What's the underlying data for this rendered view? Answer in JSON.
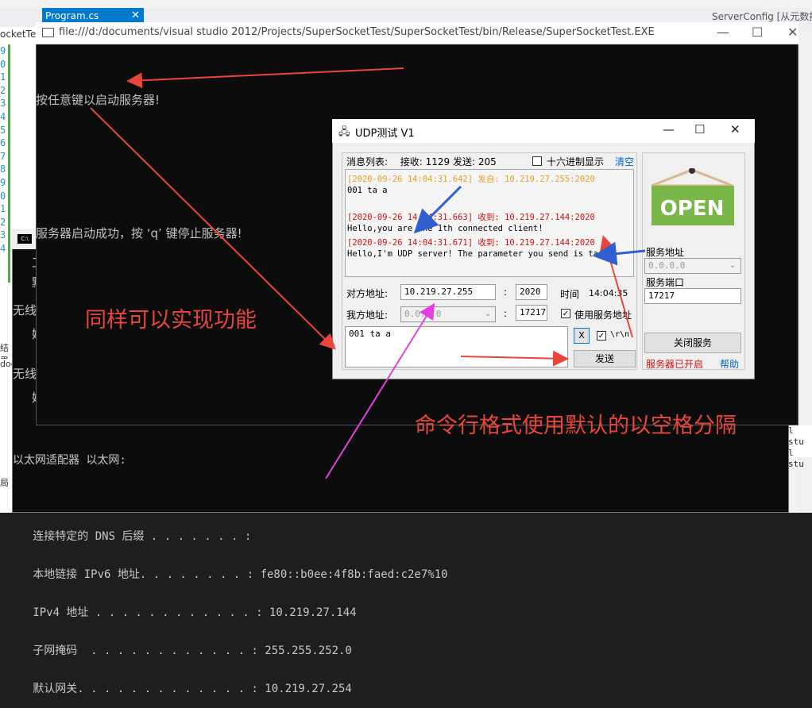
{
  "ide": {
    "tab_label": "Program.cs",
    "tab_icons": "⊕ ⊣",
    "right_title": "ServerConfig [从元数据",
    "left_text": "ocketTest",
    "line_numbers": [
      "9",
      "0",
      "1",
      "2",
      "3",
      "4",
      "5",
      "6",
      "7",
      "8",
      "9",
      "0",
      "1",
      "2",
      "3",
      "4"
    ],
    "left_fragments": [
      "无线",
      "无线",
      "结果",
      "doc",
      "局"
    ],
    "right_output": [
      "l stu",
      "l stu"
    ]
  },
  "console": {
    "title": "file:///d:/documents/visual studio 2012/Projects/SuperSocketTest/SuperSocketTest/bin/Release/SuperSocketTest.EXE",
    "lines": [
      "按任意键以启动服务器!",
      "",
      "服务器启动成功，按 ‘q’ 键停止服务器!"
    ]
  },
  "cmd2": {
    "icon_text": "C:\\",
    "adapter_lines": [
      "以太网适配器 以太网:",
      "",
      "   连接特定的 DNS 后缀 . . . . . . . :",
      "   本地链接 IPv6 地址. . . . . . . . : fe80::b0ee:4f8b:faed:c2e7%10",
      "   IPv4 地址 . . . . . . . . . . . . : 10.219.27.144",
      "   子网掩码  . . . . . . . . . . . . : 255.255.252.0",
      "   默认网关. . . . . . . . . . . . . : 10.219.27.254"
    ]
  },
  "udp": {
    "title": "UDP测试 V1",
    "msg_list_label": "消息列表:",
    "recv_label": "接收:",
    "recv_count": "1129",
    "send_label": "发送:",
    "send_count": "205",
    "hex_label": "十六进制显示",
    "clear_label": "清空",
    "messages": [
      {
        "text": "[2020-09-26 14:04:31.642]  发自: 10.219.27.255:2020",
        "color": "orange"
      },
      {
        "text": "001 ta a",
        "color": "black"
      },
      {
        "text": "",
        "color": "black"
      },
      {
        "text": "[2020-09-26 14:04:31.663]  收到: 10.219.27.144:2020",
        "color": "red"
      },
      {
        "text": "Hello,you are the 1th connected client!",
        "color": "black"
      },
      {
        "text": "[2020-09-26 14:04:31.671]  收到: 10.219.27.144:2020",
        "color": "red"
      },
      {
        "text": "Hello,I'm UDP server! The parameter you send is ta a",
        "color": "black"
      }
    ],
    "remote_addr_label": "对方地址:",
    "remote_addr": "10.219.27.255",
    "remote_port": "2020",
    "time_label": "时间",
    "time_value": "14:04:35",
    "local_addr_label": "我方地址:",
    "local_addr": "0.0.0.0",
    "local_port": "17217",
    "use_service_addr_label": "使用服务地址",
    "send_text": "001 ta a",
    "x_button": "X",
    "crlf_label": "\\r\\n",
    "send_button": "发送",
    "open_sign_text": "OPEN",
    "service_addr_label": "服务地址",
    "service_addr": "0.0.0.0",
    "service_port_label": "服务端口",
    "service_port": "17217",
    "close_service_button": "关闭服务",
    "status_text": "服务器已开启",
    "help_link": "帮助"
  },
  "annotations": {
    "same_function": "同样可以实现功能",
    "cmdline_format": "命令行格式使用默认的以空格分隔"
  },
  "colors": {
    "accent_tab": "#007acc",
    "annotation_red": "#e8463a",
    "arrow_blue": "#2f5fd0",
    "arrow_magenta": "#e040e0",
    "open_sign_green": "#7ab648"
  }
}
